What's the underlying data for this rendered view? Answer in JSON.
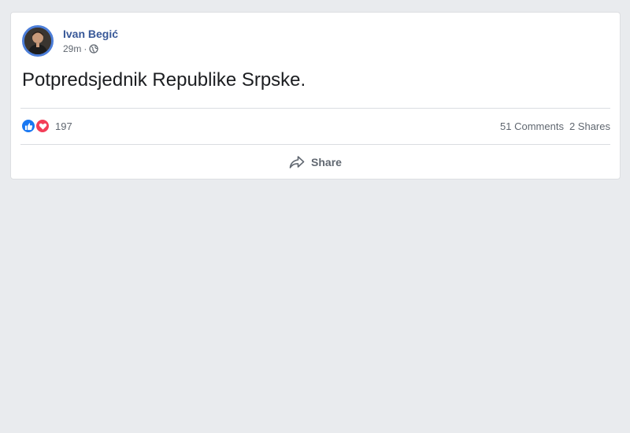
{
  "post": {
    "author_name": "Ivan Begić",
    "timestamp": "29m",
    "separator": "·",
    "audience_icon": "globe-icon",
    "text": "Potpredsjednik Republike Srpske."
  },
  "reactions": {
    "icons": [
      "like-icon",
      "love-icon"
    ],
    "count": "197",
    "comments_label": "51 Comments",
    "shares_label": "2 Shares"
  },
  "actions": {
    "share_label": "Share",
    "share_icon": "share-arrow-icon"
  },
  "colors": {
    "page_background": "#e9ebee",
    "card_background": "#ffffff",
    "author_link": "#385898",
    "secondary_text": "#606770",
    "like_blue": "#1877f2",
    "love_red": "#f33e58"
  }
}
